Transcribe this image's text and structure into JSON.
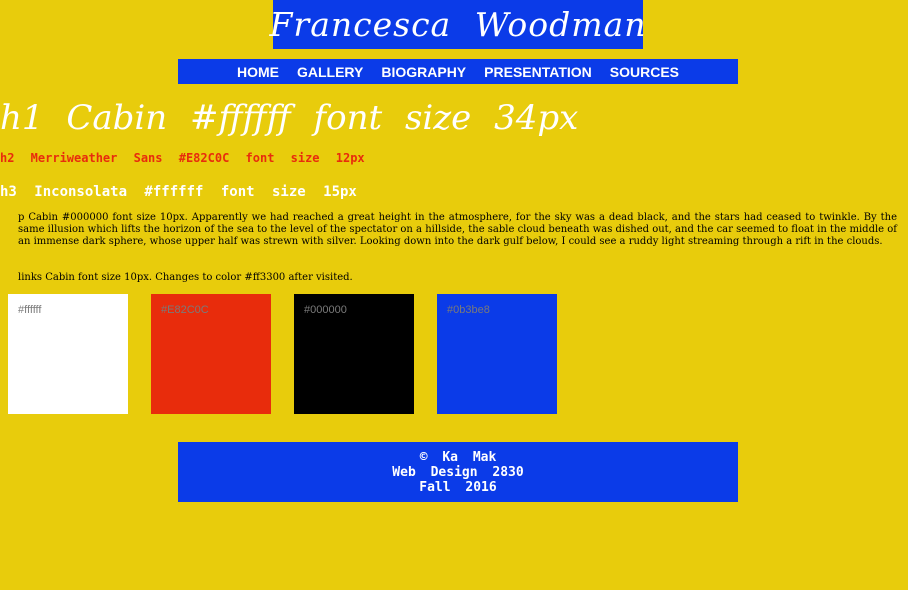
{
  "header": {
    "title": "Francesca  Woodman"
  },
  "nav": {
    "items": [
      {
        "label": "HOME"
      },
      {
        "label": "GALLERY"
      },
      {
        "label": "BIOGRAPHY"
      },
      {
        "label": "PRESENTATION"
      },
      {
        "label": "SOURCES"
      }
    ]
  },
  "samples": {
    "h1": "h1  Cabin  #ffffff  font  size  34px",
    "h2": "h2  Merriweather  Sans  #E82C0C  font  size  12px",
    "h3": "h3  Inconsolata  #ffffff  font  size  15px",
    "paragraph": "p Cabin #000000 font size 10px. Apparently we had reached a great height in the atmosphere, for the sky was a dead black, and the stars had ceased to twinkle. By the same illusion which lifts the horizon of the sea to the level of the spectator on a hillside, the sable cloud beneath was dished out, and the car seemed to float in the middle of an immense dark sphere, whose upper half was strewn with silver. Looking down into the dark gulf below, I could see a ruddy light streaming through a rift in the clouds.",
    "links": "links Cabin font size 10px. Changes to color #ff3300 after visited."
  },
  "swatches": [
    {
      "label": "#ffffff",
      "color": "#ffffff"
    },
    {
      "label": "#E82C0C",
      "color": "#E82C0C"
    },
    {
      "label": "#000000",
      "color": "#000000"
    },
    {
      "label": "#0b3be8",
      "color": "#0b3be8"
    }
  ],
  "footer": {
    "line1": "©  Ka  Mak",
    "line2": "Web  Design  2830",
    "line3": "Fall  2016"
  },
  "colors": {
    "page_background": "#e8cc0c",
    "brand_blue": "#0b3be8",
    "accent_red": "#E82C0C",
    "visited_link": "#ff3300"
  }
}
